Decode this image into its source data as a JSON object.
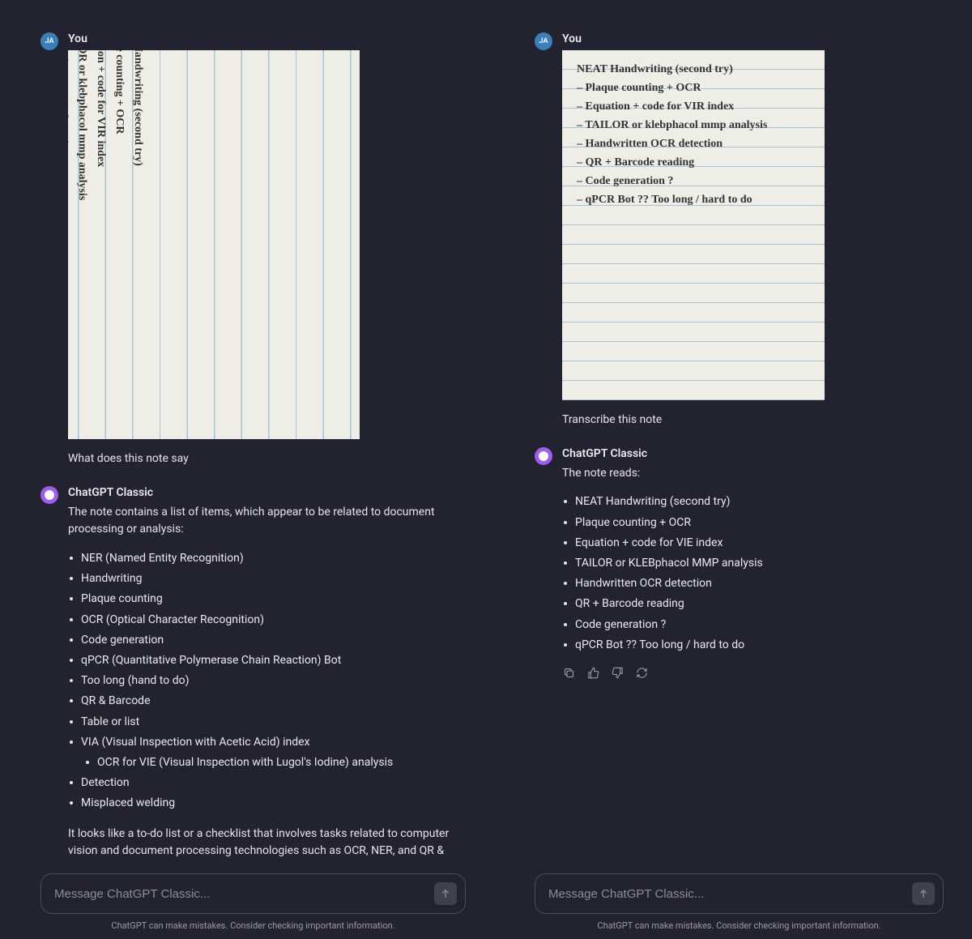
{
  "left": {
    "user_avatar": "JA",
    "user_label": "You",
    "user_prompt": "What does this note say",
    "bot_label": "ChatGPT Classic",
    "bot_intro": "The note contains a list of items, which appear to be related to document processing or analysis:",
    "bot_items": [
      "NER (Named Entity Recognition)",
      "Handwriting",
      "Plaque counting",
      "OCR (Optical Character Recognition)",
      "Code generation",
      "qPCR (Quantitative Polymerase Chain Reaction) Bot",
      "Too long (hand to do)",
      "QR & Barcode",
      "Table or list",
      "VIA (Visual Inspection with Acetic Acid) index",
      "OCR for VIE (Visual Inspection with Lugol's Iodine) analysis",
      "Detection",
      "Misplaced welding"
    ],
    "bot_outro": "It looks like a to-do list or a checklist that involves tasks related to computer vision and document processing technologies such as OCR, NER, and QR & Barcode detection, as well as some specific applications like qPCR Bot and VIA index analysis.",
    "note_text": "NEAT Handwriting (second try)\n– Plaque counting + OCR\n– Equation + code for VIR index\n– TAILOR or klebphacol mmp analysis\n– Handwritten OCR detection\n– QR + Barcode reading\n– Code generation ?\n– qPCR Bot ?? Too long / hard to do",
    "placeholder": "Message ChatGPT Classic...",
    "disclaimer": "ChatGPT can make mistakes. Consider checking important information."
  },
  "right": {
    "user_avatar": "JA",
    "user_label": "You",
    "user_prompt": "Transcribe this note",
    "bot_label": "ChatGPT Classic",
    "bot_intro": "The note reads:",
    "bot_items": [
      "NEAT Handwriting (second try)",
      "Plaque counting + OCR",
      "Equation + code for VIE index",
      "TAILOR or KLEBphacol MMP analysis",
      "Handwritten OCR detection",
      "QR + Barcode reading",
      "Code generation ?",
      "qPCR Bot ?? Too long / hard to do"
    ],
    "note_text": "NEAT Handwriting (second try)\n– Plaque counting + OCR\n– Equation + code for VIR index\n– TAILOR or klebphacol mmp analysis\n– Handwritten OCR detection\n– QR + Barcode reading\n– Code generation ?\n– qPCR Bot ?? Too long / hard to do",
    "placeholder": "Message ChatGPT Classic...",
    "disclaimer": "ChatGPT can make mistakes. Consider checking important information."
  }
}
